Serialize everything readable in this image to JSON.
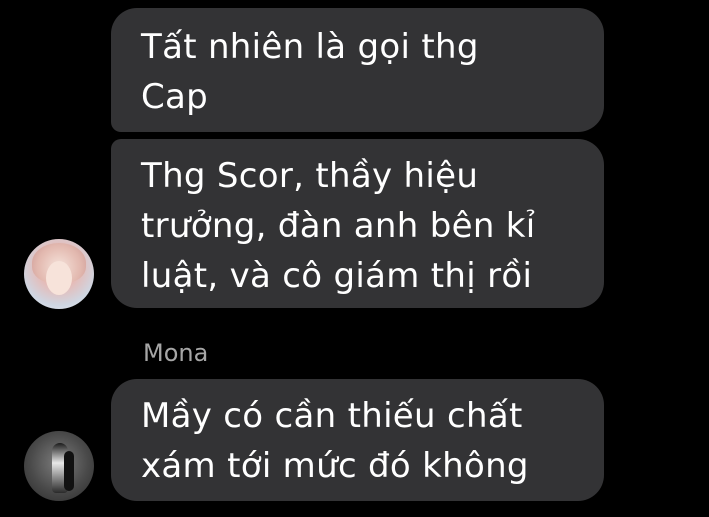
{
  "colors": {
    "background": "#000000",
    "bubble": "#333335",
    "message_text": "#ffffff",
    "sender_name": "#a6a6a6"
  },
  "messages": [
    {
      "lines": [
        "Tất nhiên là gọi thg",
        "Cap"
      ]
    },
    {
      "lines": [
        "Thg Scor, thầy hiệu",
        "trưởng, đàn anh bên kỉ",
        "luật, và cô giám thị rồi"
      ]
    },
    {
      "sender": "Mona",
      "lines": [
        "Mầy có cần thiếu chất",
        "xám tới mức đó không"
      ]
    }
  ]
}
